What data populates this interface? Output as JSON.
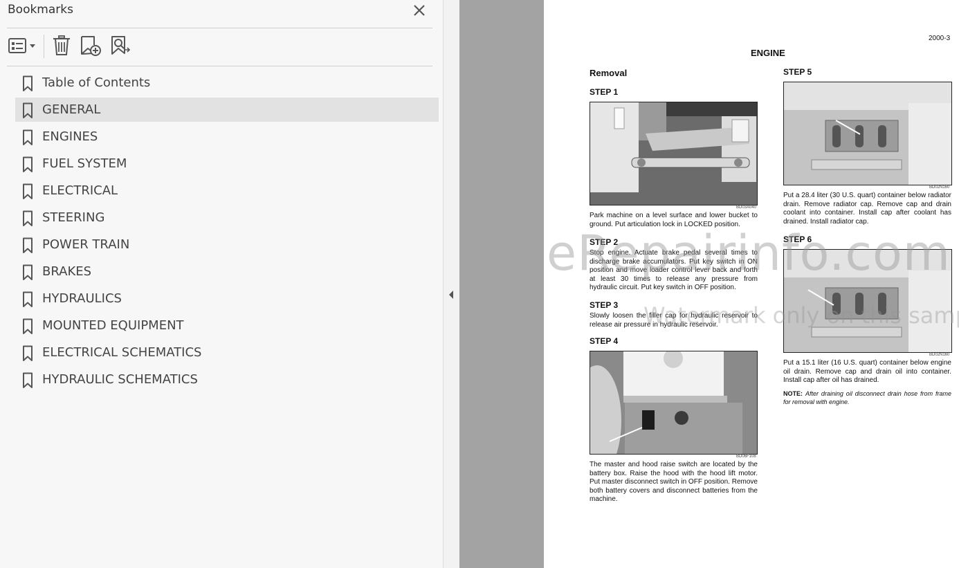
{
  "panel": {
    "title": "Bookmarks",
    "tools": [
      "options-menu-icon",
      "delete-bookmark-icon",
      "new-bookmark-icon",
      "find-bookmark-icon"
    ],
    "items": [
      {
        "label": "Table of Contents",
        "selected": false
      },
      {
        "label": "GENERAL",
        "selected": true
      },
      {
        "label": "ENGINES",
        "selected": false
      },
      {
        "label": "FUEL SYSTEM",
        "selected": false
      },
      {
        "label": "ELECTRICAL",
        "selected": false
      },
      {
        "label": "STEERING",
        "selected": false
      },
      {
        "label": "POWER TRAIN",
        "selected": false
      },
      {
        "label": "BRAKES",
        "selected": false
      },
      {
        "label": "HYDRAULICS",
        "selected": false
      },
      {
        "label": "MOUNTED EQUIPMENT",
        "selected": false
      },
      {
        "label": "ELECTRICAL SCHEMATICS",
        "selected": false
      },
      {
        "label": "HYDRAULIC SCHEMATICS",
        "selected": false
      }
    ]
  },
  "document": {
    "page_number": "2000-3",
    "section_title": "ENGINE",
    "subtitle": "Removal",
    "steps": [
      {
        "label": "STEP 1",
        "figure": "BD03A040",
        "text": "Park machine on a level surface and lower bucket to ground. Put articulation lock in LOCKED position."
      },
      {
        "label": "STEP 2",
        "text": "Stop engine. Actuate brake pedal several times to discharge brake accumulators. Put key switch in ON position and move loader control lever back and forth at least 30 times to release any pressure from hydraulic circuit. Put key switch in OFF position."
      },
      {
        "label": "STEP 3",
        "text": "Slowly loosen the filler cap for hydraulic reservoir to release air pressure in hydraulic reservoir."
      },
      {
        "label": "STEP 4",
        "figure": "BD06F108",
        "text": "The master and hood raise switch are located by the battery box. Raise the hood with the hood lift motor. Put master disconnect switch in OFF position. Remove both battery covers and disconnect batteries from the machine."
      },
      {
        "label": "STEP 5",
        "figure": "BD02N160",
        "text": "Put a 28.4 liter (30 U.S. quart) container below radiator drain. Remove radiator cap. Remove cap and drain coolant into container. Install cap after coolant has drained. Install radiator cap."
      },
      {
        "label": "STEP 6",
        "figure": "BD02N160",
        "text": "Put a 15.1 liter (16 U.S. quart) container below engine oil drain. Remove cap and drain oil into container. Install cap after oil has drained."
      }
    ],
    "note_label": "NOTE:",
    "note_text": "After draining oil disconnect drain hose from frame for removal with engine.",
    "watermark": "eRepairinfo.com",
    "watermark_sub": "Watermark only on this sample"
  }
}
